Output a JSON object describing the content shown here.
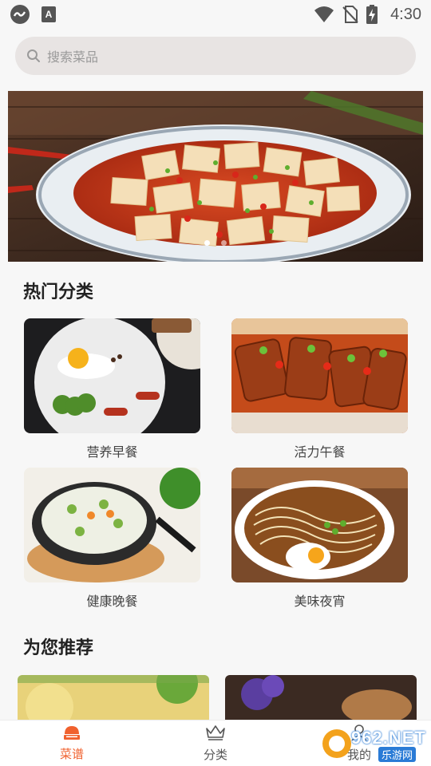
{
  "status_bar": {
    "time": "4:30",
    "left_icons": [
      "app-badge-icon",
      "keyboard-a-icon"
    ],
    "right_icons": [
      "wifi-icon",
      "no-sim-icon",
      "battery-charging-icon"
    ]
  },
  "search": {
    "placeholder": "搜索菜品"
  },
  "banner": {
    "page_count": 2,
    "active_index": 0
  },
  "hot_categories": {
    "title": "热门分类",
    "items": [
      {
        "label": "营养早餐"
      },
      {
        "label": "活力午餐"
      },
      {
        "label": "健康晚餐"
      },
      {
        "label": "美味夜宵"
      }
    ]
  },
  "recommend": {
    "title": "为您推荐"
  },
  "bottom_nav": {
    "items": [
      {
        "label": "菜谱",
        "active": true
      },
      {
        "label": "分类",
        "active": false
      },
      {
        "label": "我的",
        "active": false
      }
    ]
  },
  "watermark": {
    "brand": "962.NET",
    "sub": "乐游网"
  },
  "colors": {
    "accent": "#f0612e",
    "search_bg": "#e8e4e3",
    "background": "#f7f7f7"
  }
}
